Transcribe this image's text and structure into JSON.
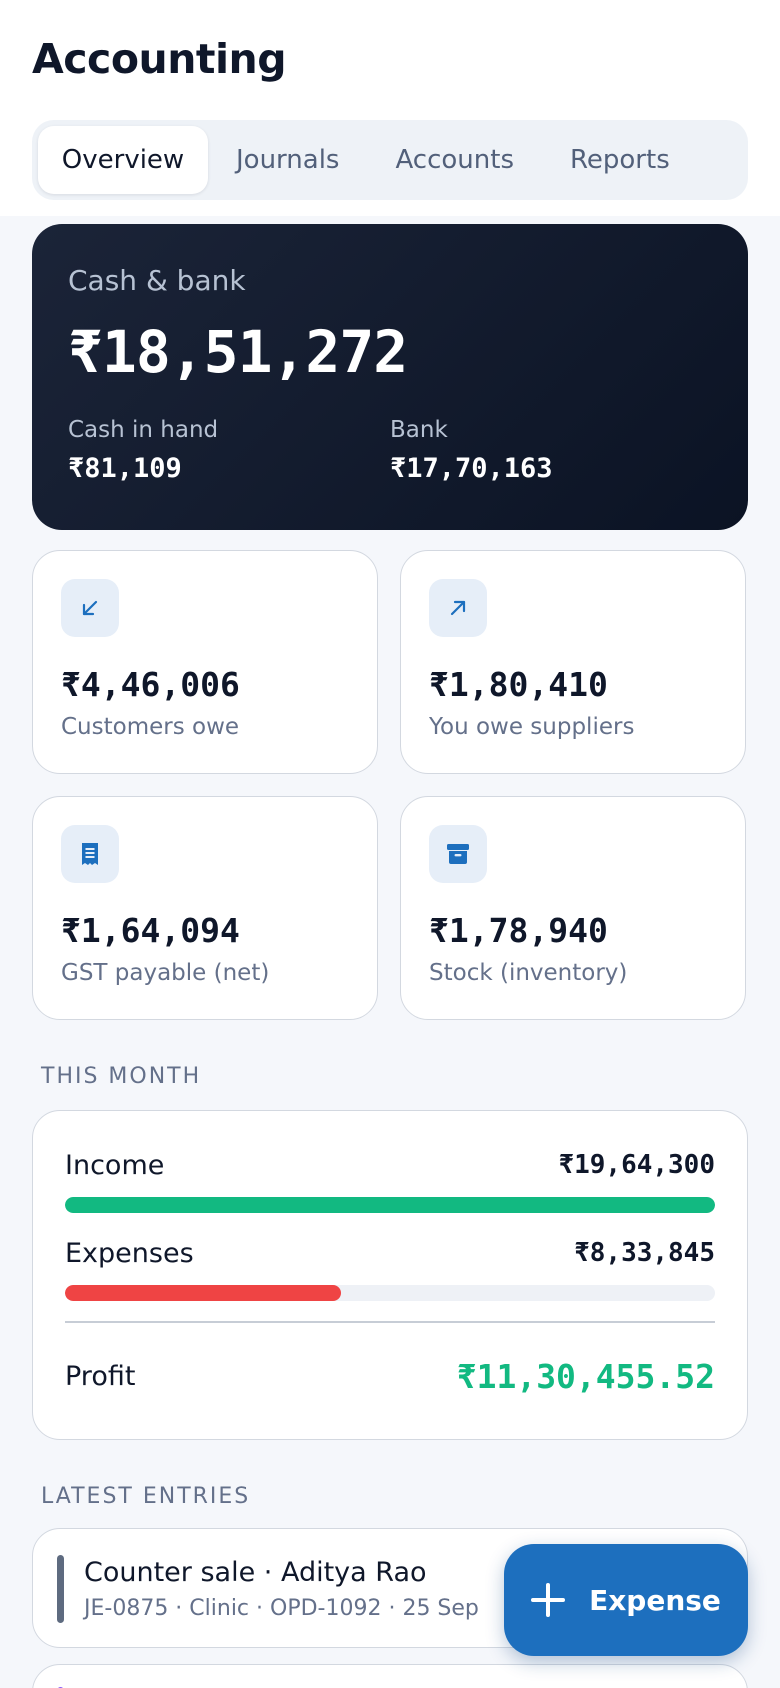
{
  "app": {
    "title": "Accounting"
  },
  "tabs": [
    {
      "label": "Overview",
      "active": true
    },
    {
      "label": "Journals",
      "active": false
    },
    {
      "label": "Accounts",
      "active": false
    },
    {
      "label": "Reports",
      "active": false
    }
  ],
  "cash": {
    "label": "Cash & bank",
    "total": "₹18,51,272",
    "cash_in_hand_label": "Cash in hand",
    "cash_in_hand_value": "₹81,109",
    "bank_label": "Bank",
    "bank_value": "₹17,70,163"
  },
  "stats": [
    {
      "icon": "arrow-down-left-icon",
      "value": "₹4,46,006",
      "label": "Customers owe"
    },
    {
      "icon": "arrow-up-right-icon",
      "value": "₹1,80,410",
      "label": "You owe suppliers"
    },
    {
      "icon": "receipt-icon",
      "value": "₹1,64,094",
      "label": "GST payable (net)"
    },
    {
      "icon": "archive-box-icon",
      "value": "₹1,78,940",
      "label": "Stock (inventory)"
    }
  ],
  "this_month": {
    "section_title": "THIS MONTH",
    "income_label": "Income",
    "income_value": "₹19,64,300",
    "income_fill": 1.0,
    "expenses_label": "Expenses",
    "expenses_value": "₹8,33,845",
    "expenses_fill": 0.424,
    "profit_label": "Profit",
    "profit_value": "₹11,30,455.52",
    "colors": {
      "income": "#12b981",
      "expenses": "#ef4444",
      "profit": "#12b981"
    }
  },
  "latest": {
    "section_title": "LATEST ENTRIES",
    "entries": [
      {
        "title": "Counter sale · Aditya Rao",
        "meta": "JE-0875 · Clinic · OPD-1092 · 25 Sep"
      }
    ]
  },
  "fab": {
    "label": "Expense",
    "icon": "plus-icon"
  },
  "colors": {
    "accent": "#1d6fbe",
    "dark_card": "#0f172a"
  }
}
